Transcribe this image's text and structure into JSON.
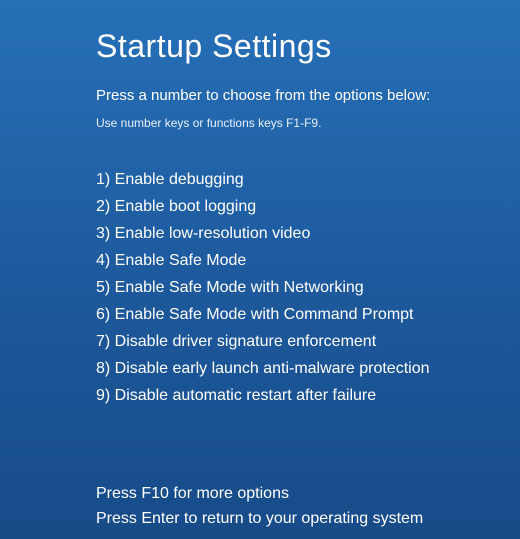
{
  "title": "Startup Settings",
  "subtitle": "Press a number to choose from the options below:",
  "hint": "Use number keys or functions keys F1-F9.",
  "options": [
    "1) Enable debugging",
    "2) Enable boot logging",
    "3) Enable low-resolution video",
    "4) Enable Safe Mode",
    "5) Enable Safe Mode with Networking",
    "6) Enable Safe Mode with Command Prompt",
    "7) Disable driver signature enforcement",
    "8) Disable early launch anti-malware protection",
    "9) Disable automatic restart after failure"
  ],
  "footer": {
    "more_options": "Press F10 for more options",
    "return_line": "Press Enter to return to your operating system"
  }
}
